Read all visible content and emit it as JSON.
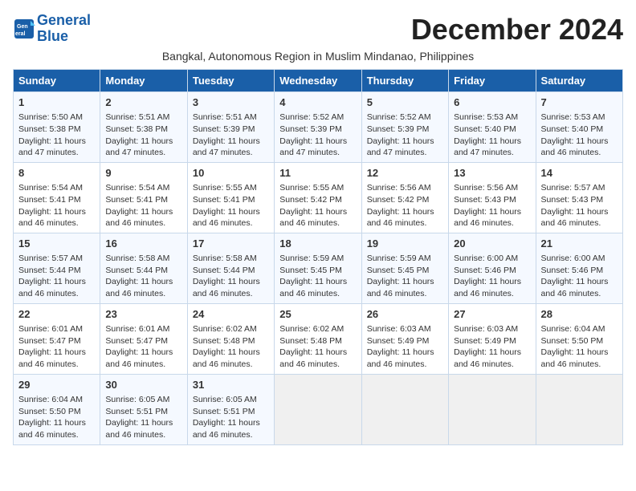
{
  "logo": {
    "line1": "General",
    "line2": "Blue"
  },
  "title": "December 2024",
  "location": "Bangkal, Autonomous Region in Muslim Mindanao, Philippines",
  "days_of_week": [
    "Sunday",
    "Monday",
    "Tuesday",
    "Wednesday",
    "Thursday",
    "Friday",
    "Saturday"
  ],
  "weeks": [
    [
      {
        "day": "1",
        "info": "Sunrise: 5:50 AM\nSunset: 5:38 PM\nDaylight: 11 hours and 47 minutes."
      },
      {
        "day": "2",
        "info": "Sunrise: 5:51 AM\nSunset: 5:38 PM\nDaylight: 11 hours and 47 minutes."
      },
      {
        "day": "3",
        "info": "Sunrise: 5:51 AM\nSunset: 5:39 PM\nDaylight: 11 hours and 47 minutes."
      },
      {
        "day": "4",
        "info": "Sunrise: 5:52 AM\nSunset: 5:39 PM\nDaylight: 11 hours and 47 minutes."
      },
      {
        "day": "5",
        "info": "Sunrise: 5:52 AM\nSunset: 5:39 PM\nDaylight: 11 hours and 47 minutes."
      },
      {
        "day": "6",
        "info": "Sunrise: 5:53 AM\nSunset: 5:40 PM\nDaylight: 11 hours and 47 minutes."
      },
      {
        "day": "7",
        "info": "Sunrise: 5:53 AM\nSunset: 5:40 PM\nDaylight: 11 hours and 46 minutes."
      }
    ],
    [
      {
        "day": "8",
        "info": "Sunrise: 5:54 AM\nSunset: 5:41 PM\nDaylight: 11 hours and 46 minutes."
      },
      {
        "day": "9",
        "info": "Sunrise: 5:54 AM\nSunset: 5:41 PM\nDaylight: 11 hours and 46 minutes."
      },
      {
        "day": "10",
        "info": "Sunrise: 5:55 AM\nSunset: 5:41 PM\nDaylight: 11 hours and 46 minutes."
      },
      {
        "day": "11",
        "info": "Sunrise: 5:55 AM\nSunset: 5:42 PM\nDaylight: 11 hours and 46 minutes."
      },
      {
        "day": "12",
        "info": "Sunrise: 5:56 AM\nSunset: 5:42 PM\nDaylight: 11 hours and 46 minutes."
      },
      {
        "day": "13",
        "info": "Sunrise: 5:56 AM\nSunset: 5:43 PM\nDaylight: 11 hours and 46 minutes."
      },
      {
        "day": "14",
        "info": "Sunrise: 5:57 AM\nSunset: 5:43 PM\nDaylight: 11 hours and 46 minutes."
      }
    ],
    [
      {
        "day": "15",
        "info": "Sunrise: 5:57 AM\nSunset: 5:44 PM\nDaylight: 11 hours and 46 minutes."
      },
      {
        "day": "16",
        "info": "Sunrise: 5:58 AM\nSunset: 5:44 PM\nDaylight: 11 hours and 46 minutes."
      },
      {
        "day": "17",
        "info": "Sunrise: 5:58 AM\nSunset: 5:44 PM\nDaylight: 11 hours and 46 minutes."
      },
      {
        "day": "18",
        "info": "Sunrise: 5:59 AM\nSunset: 5:45 PM\nDaylight: 11 hours and 46 minutes."
      },
      {
        "day": "19",
        "info": "Sunrise: 5:59 AM\nSunset: 5:45 PM\nDaylight: 11 hours and 46 minutes."
      },
      {
        "day": "20",
        "info": "Sunrise: 6:00 AM\nSunset: 5:46 PM\nDaylight: 11 hours and 46 minutes."
      },
      {
        "day": "21",
        "info": "Sunrise: 6:00 AM\nSunset: 5:46 PM\nDaylight: 11 hours and 46 minutes."
      }
    ],
    [
      {
        "day": "22",
        "info": "Sunrise: 6:01 AM\nSunset: 5:47 PM\nDaylight: 11 hours and 46 minutes."
      },
      {
        "day": "23",
        "info": "Sunrise: 6:01 AM\nSunset: 5:47 PM\nDaylight: 11 hours and 46 minutes."
      },
      {
        "day": "24",
        "info": "Sunrise: 6:02 AM\nSunset: 5:48 PM\nDaylight: 11 hours and 46 minutes."
      },
      {
        "day": "25",
        "info": "Sunrise: 6:02 AM\nSunset: 5:48 PM\nDaylight: 11 hours and 46 minutes."
      },
      {
        "day": "26",
        "info": "Sunrise: 6:03 AM\nSunset: 5:49 PM\nDaylight: 11 hours and 46 minutes."
      },
      {
        "day": "27",
        "info": "Sunrise: 6:03 AM\nSunset: 5:49 PM\nDaylight: 11 hours and 46 minutes."
      },
      {
        "day": "28",
        "info": "Sunrise: 6:04 AM\nSunset: 5:50 PM\nDaylight: 11 hours and 46 minutes."
      }
    ],
    [
      {
        "day": "29",
        "info": "Sunrise: 6:04 AM\nSunset: 5:50 PM\nDaylight: 11 hours and 46 minutes."
      },
      {
        "day": "30",
        "info": "Sunrise: 6:05 AM\nSunset: 5:51 PM\nDaylight: 11 hours and 46 minutes."
      },
      {
        "day": "31",
        "info": "Sunrise: 6:05 AM\nSunset: 5:51 PM\nDaylight: 11 hours and 46 minutes."
      },
      null,
      null,
      null,
      null
    ]
  ]
}
